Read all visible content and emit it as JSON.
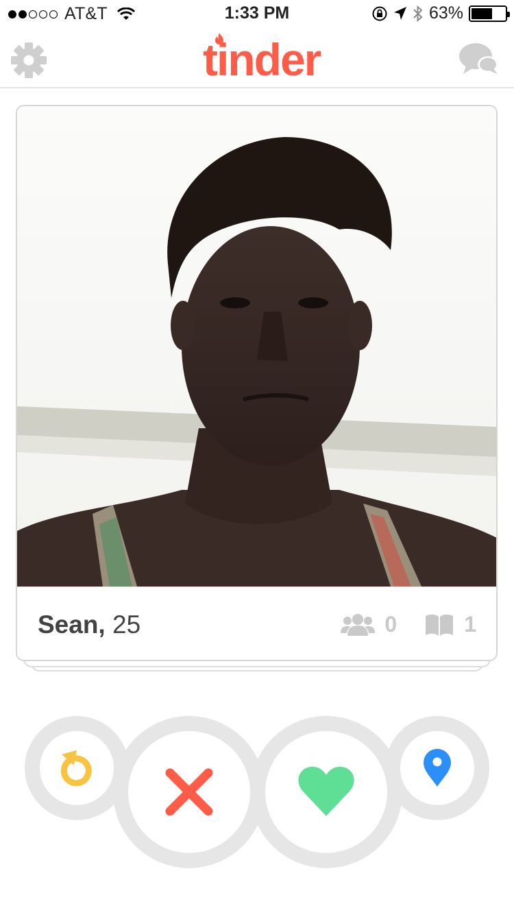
{
  "status_bar": {
    "signal_bars": 2,
    "signal_total": 5,
    "carrier": "AT&T",
    "time": "1:33 PM",
    "battery_percent": "63%",
    "battery_level": 0.63,
    "icons": [
      "wifi-icon",
      "rotation-lock-icon",
      "location-arrow-icon",
      "bluetooth-icon",
      "battery-icon"
    ]
  },
  "nav": {
    "logo": "tinder",
    "left_icon": "settings-gear-icon",
    "right_icon": "messages-icon"
  },
  "profile": {
    "name": "Sean,",
    "age": "25",
    "shared_friends": "0",
    "shared_interests": "1",
    "friends_icon": "shared-friends-icon",
    "interests_icon": "book-icon"
  },
  "actions": [
    {
      "id": "rewind",
      "icon": "rewind-icon",
      "color": "#f7c341"
    },
    {
      "id": "nope",
      "icon": "x-icon",
      "color": "#fd5c48"
    },
    {
      "id": "like",
      "icon": "heart-icon",
      "color": "#5fdf96"
    },
    {
      "id": "location",
      "icon": "location-pin-icon",
      "color": "#2c8ff7"
    }
  ],
  "colors": {
    "brand": "#fd5c48",
    "ring": "#e6e6e6",
    "muted_icon": "#c9c9c9",
    "name_text": "#424242"
  }
}
